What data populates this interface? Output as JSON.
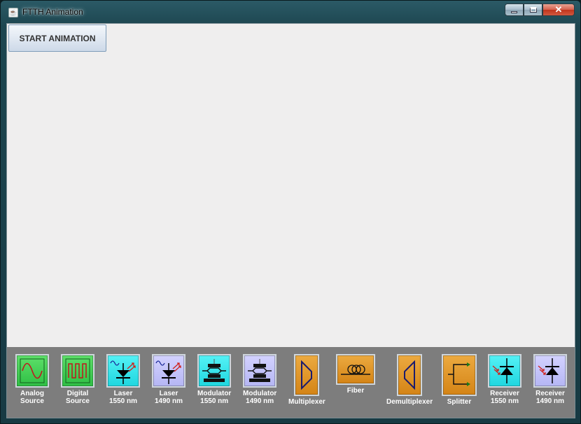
{
  "window": {
    "title": "FTTH Animation"
  },
  "toolbar": {
    "start_label": "START ANIMATION"
  },
  "palette": {
    "components": [
      {
        "id": "analog-source",
        "line1": "Analog",
        "line2": "Source",
        "icon": "sine-wave-icon"
      },
      {
        "id": "digital-source",
        "line1": "Digital",
        "line2": "Source",
        "icon": "square-wave-icon"
      },
      {
        "id": "laser-1550",
        "line1": "Laser",
        "line2": "1550 nm",
        "icon": "laser-diode-icon"
      },
      {
        "id": "laser-1490",
        "line1": "Laser",
        "line2": "1490 nm",
        "icon": "laser-diode-icon"
      },
      {
        "id": "modulator-1550",
        "line1": "Modulator",
        "line2": "1550 nm",
        "icon": "modulator-icon"
      },
      {
        "id": "modulator-1490",
        "line1": "Modulator",
        "line2": "1490 nm",
        "icon": "modulator-icon"
      },
      {
        "id": "multiplexer",
        "line1": "Multiplexer",
        "line2": "",
        "icon": "multiplexer-icon"
      },
      {
        "id": "fiber",
        "line1": "Fiber",
        "line2": "",
        "icon": "fiber-coil-icon"
      },
      {
        "id": "demultiplexer",
        "line1": "Demultiplexer",
        "line2": "",
        "icon": "demultiplexer-icon"
      },
      {
        "id": "splitter",
        "line1": "Splitter",
        "line2": "",
        "icon": "splitter-icon"
      },
      {
        "id": "receiver-1550",
        "line1": "Receiver",
        "line2": "1550 nm",
        "icon": "photodiode-icon"
      },
      {
        "id": "receiver-1490",
        "line1": "Receiver",
        "line2": "1490 nm",
        "icon": "photodiode-icon"
      }
    ]
  },
  "colors": {
    "panel": "#7d7d7d",
    "canvas": "#efeeee",
    "green": "#2fbf45",
    "cyan": "#1fd6df",
    "lavender": "#b5b6f4",
    "orange": "#d48416"
  }
}
